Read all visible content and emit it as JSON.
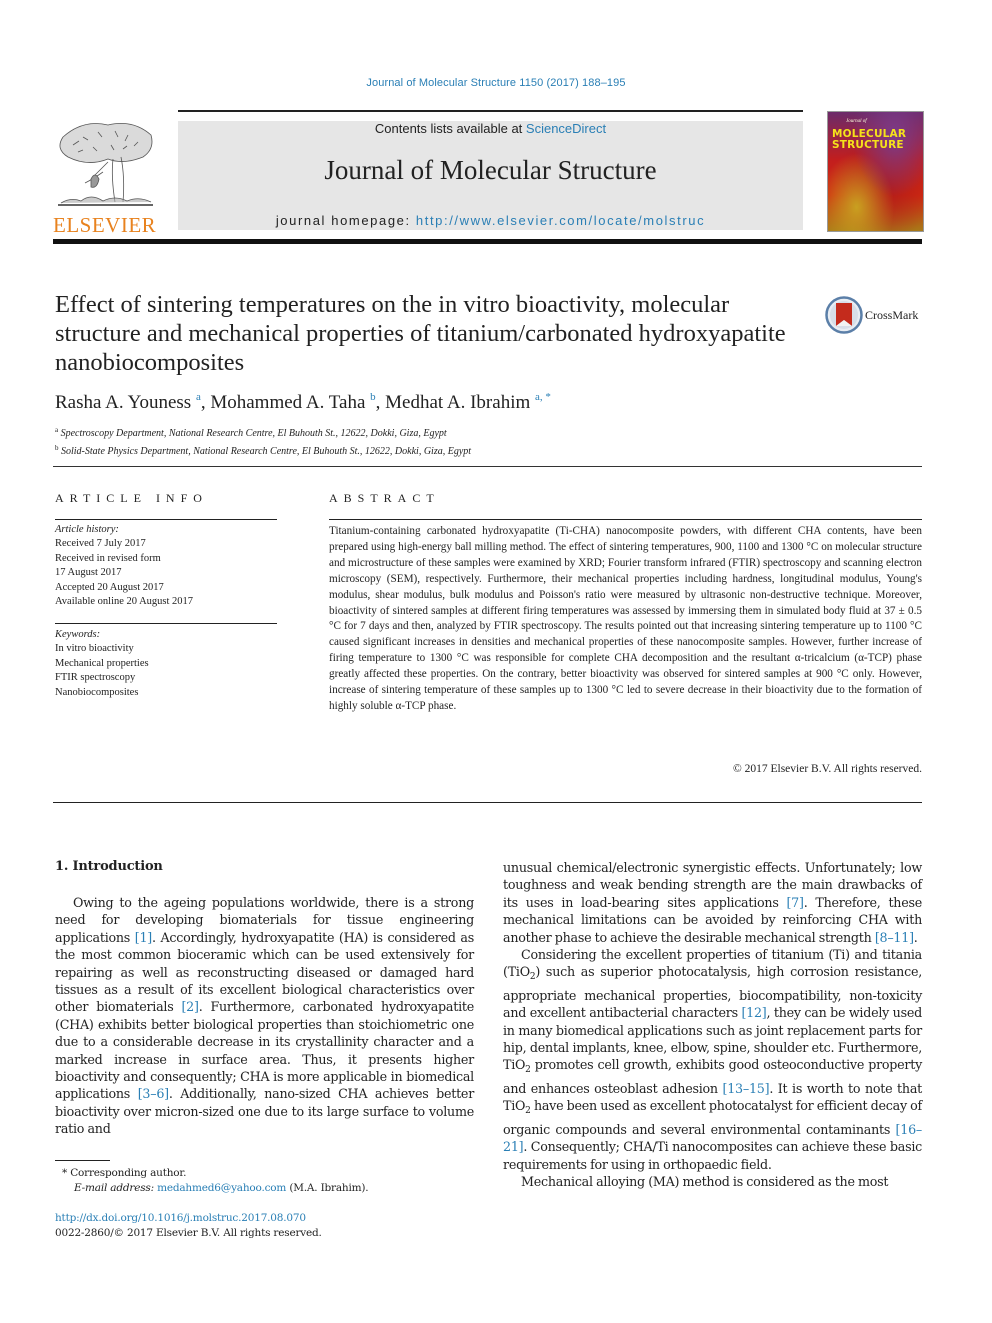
{
  "header": {
    "citation": "Journal of Molecular Structure 1150 (2017) 188–195",
    "contents_prefix": "Contents lists available at ",
    "contents_link": "ScienceDirect",
    "journal_name": "Journal of Molecular Structure",
    "homepage_prefix": "journal homepage: ",
    "homepage_url": "http://www.elsevier.com/locate/molstruc",
    "publisher_logo_text": "ELSEVIER",
    "cover_title_line1": "MOLECULAR",
    "cover_title_line2": "STRUCTURE",
    "cover_subtitle": "Journal of",
    "crossmark_label": "CrossMark",
    "colors": {
      "link": "#2a7fb5",
      "elsevier_orange": "#e8821e",
      "banner_bg": "#e6e6e6"
    }
  },
  "article": {
    "title": "Effect of sintering temperatures on the in vitro bioactivity, molecular structure and mechanical properties of titanium/carbonated hydroxyapatite nanobiocomposites",
    "authors": [
      {
        "name": "Rasha A. Youness",
        "sup": "a"
      },
      {
        "name": "Mohammed A. Taha",
        "sup": "b"
      },
      {
        "name": "Medhat A. Ibrahim",
        "sup": "a, *"
      }
    ],
    "affiliations": [
      {
        "sup": "a",
        "text": "Spectroscopy Department, National Research Centre, El Buhouth St., 12622, Dokki, Giza, Egypt"
      },
      {
        "sup": "b",
        "text": "Solid-State Physics Department, National Research Centre, El Buhouth St., 12622, Dokki, Giza, Egypt"
      }
    ]
  },
  "article_info": {
    "heading": "ARTICLE INFO",
    "history_label": "Article history:",
    "history": [
      "Received 7 July 2017",
      "Received in revised form",
      "17 August 2017",
      "Accepted 20 August 2017",
      "Available online 20 August 2017"
    ],
    "keywords_label": "Keywords:",
    "keywords": [
      "In vitro bioactivity",
      "Mechanical properties",
      "FTIR spectroscopy",
      "Nanobiocomposites"
    ]
  },
  "abstract": {
    "heading": "ABSTRACT",
    "text": "Titanium-containing carbonated hydroxyapatite (Ti-CHA) nanocomposite powders, with different CHA contents, have been prepared using high-energy ball milling method. The effect of sintering temperatures, 900, 1100 and 1300 °C on molecular structure and microstructure of these samples were examined by XRD; Fourier transform infrared (FTIR) spectroscopy and scanning electron microscopy (SEM), respectively. Furthermore, their mechanical properties including hardness, longitudinal modulus, Young's modulus, shear modulus, bulk modulus and Poisson's ratio were measured by ultrasonic non-destructive technique. Moreover, bioactivity of sintered samples at different firing temperatures was assessed by immersing them in simulated body fluid at 37 ± 0.5 °C for 7 days and then, analyzed by FTIR spectroscopy. The results pointed out that increasing sintering temperature up to 1100 °C caused significant increases in densities and mechanical properties of these nanocomposite samples. However, further increase of firing temperature to 1300 °C was responsible for complete CHA decomposition and the resultant α-tricalcium (α-TCP) phase greatly affected these properties. On the contrary, better bioactivity was observed for sintered samples at 900 °C only. However, increase of sintering temperature of these samples up to 1300 °C led to severe decrease in their bioactivity due to the formation of highly soluble α-TCP phase.",
    "copyright": "© 2017 Elsevier B.V. All rights reserved."
  },
  "body": {
    "section_heading": "1.  Introduction",
    "left": {
      "p1_a": "Owing to the ageing populations worldwide, there is a strong need for developing biomaterials for tissue engineering applications ",
      "p1_ref1": "[1]",
      "p1_b": ". Accordingly, hydroxyapatite (HA) is considered as the most common bioceramic which can be used extensively for repairing as well as reconstructing diseased or damaged hard tissues as a result of its excellent biological characteristics over other biomaterials ",
      "p1_ref2": "[2]",
      "p1_c": ". Furthermore, carbonated hydroxyapatite (CHA) exhibits better biological properties than stoichiometric one due to a considerable decrease in its crystallinity character and a marked increase in surface area. Thus, it presents higher bioactivity and consequently; CHA is more applicable in biomedical applications ",
      "p1_ref3": "[3–6]",
      "p1_d": ". Additionally, nano-sized CHA achieves better bioactivity over micron-sized one due to its large surface to volume ratio and"
    },
    "right": {
      "p1_a": "unusual chemical/electronic synergistic effects. Unfortunately; low toughness and weak bending strength are the main drawbacks of its uses in load-bearing sites applications ",
      "p1_ref1": "[7]",
      "p1_b": ". Therefore, these mechanical limitations can be avoided by reinforcing CHA with another phase to achieve the desirable mechanical strength ",
      "p1_ref2": "[8–11]",
      "p1_c": ".",
      "p2_a": "Considering the excellent properties of titanium (Ti) and titania (TiO",
      "p2_sub1": "2",
      "p2_b": ") such as superior photocatalysis, high corrosion resistance, appropriate mechanical properties, biocompatibility, non-toxicity and excellent antibacterial characters ",
      "p2_ref1": "[12]",
      "p2_c": ", they can be widely used in many biomedical applications such as joint replacement parts for hip, dental implants, knee, elbow, spine, shoulder etc. Furthermore, TiO",
      "p2_sub2": "2",
      "p2_d": " promotes cell growth, exhibits good osteoconductive property and enhances osteoblast adhesion ",
      "p2_ref2": "[13–15]",
      "p2_e": ". It is worth to note that TiO",
      "p2_sub3": "2",
      "p2_f": " have been used as excellent photocatalyst for efficient decay of organic compounds and several environmental contaminants ",
      "p2_ref3": "[16–21]",
      "p2_g": ". Consequently; CHA/Ti nanocomposites can achieve these basic requirements for using in orthopaedic field.",
      "p3": "Mechanical alloying (MA) method is considered as the most"
    }
  },
  "footnotes": {
    "corresponding": "* Corresponding author.",
    "email_label": "E-mail address: ",
    "email": "medahmed6@yahoo.com",
    "email_suffix": " (M.A. Ibrahim).",
    "doi": "http://dx.doi.org/10.1016/j.molstruc.2017.08.070",
    "issn": "0022-2860/© 2017 Elsevier B.V. All rights reserved."
  }
}
